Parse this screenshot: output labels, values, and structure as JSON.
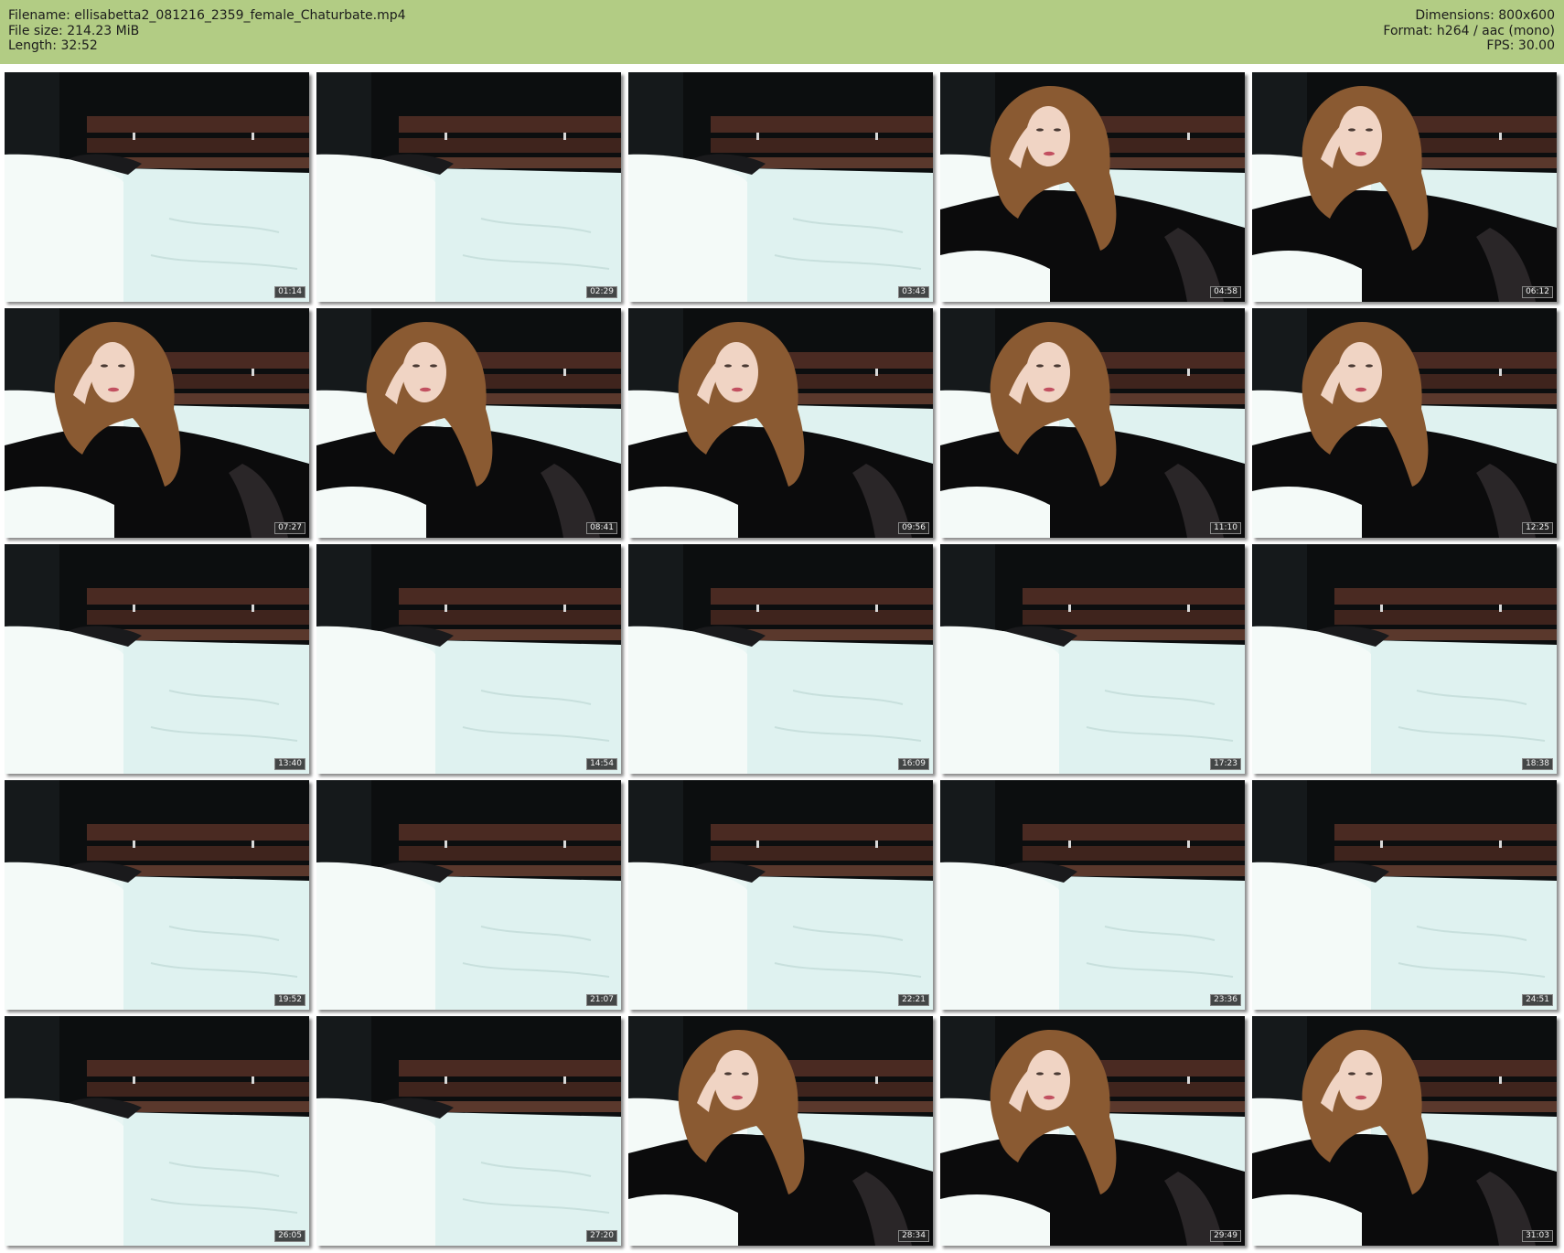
{
  "header": {
    "filename": "Filename: ellisabetta2_081216_2359_female_Chaturbate.mp4",
    "filesize": "File size: 214.23 MiB",
    "length": "Length: 32:52",
    "dimensions": "Dimensions: 800x600",
    "format": "Format: h264 / aac (mono)",
    "fps": "FPS: 30.00"
  },
  "colors": {
    "header_bg": "#b2cc84",
    "frame_dark": "#0c0e0f",
    "headboard": "#4a2a22",
    "sheet": "#e9f6f4",
    "hair": "#8a5a32",
    "dress": "#0b0b0c",
    "skin": "#f0d4c4"
  },
  "frames": [
    {
      "time": "01:14",
      "scene": "empty-bed"
    },
    {
      "time": "02:29",
      "scene": "empty-bed"
    },
    {
      "time": "03:43",
      "scene": "empty-bed"
    },
    {
      "time": "04:58",
      "scene": "woman-reclining"
    },
    {
      "time": "06:12",
      "scene": "woman-reclining"
    },
    {
      "time": "07:27",
      "scene": "woman-reclining"
    },
    {
      "time": "08:41",
      "scene": "woman-reclining"
    },
    {
      "time": "09:56",
      "scene": "woman-reclining"
    },
    {
      "time": "11:10",
      "scene": "woman-reclining"
    },
    {
      "time": "12:25",
      "scene": "woman-reclining"
    },
    {
      "time": "13:40",
      "scene": "empty-bed"
    },
    {
      "time": "14:54",
      "scene": "empty-bed"
    },
    {
      "time": "16:09",
      "scene": "empty-bed"
    },
    {
      "time": "17:23",
      "scene": "empty-bed"
    },
    {
      "time": "18:38",
      "scene": "empty-bed"
    },
    {
      "time": "19:52",
      "scene": "empty-bed"
    },
    {
      "time": "21:07",
      "scene": "empty-bed"
    },
    {
      "time": "22:21",
      "scene": "empty-bed"
    },
    {
      "time": "23:36",
      "scene": "empty-bed"
    },
    {
      "time": "24:51",
      "scene": "empty-bed"
    },
    {
      "time": "26:05",
      "scene": "empty-bed"
    },
    {
      "time": "27:20",
      "scene": "empty-bed"
    },
    {
      "time": "28:34",
      "scene": "woman-reclining"
    },
    {
      "time": "29:49",
      "scene": "woman-reclining"
    },
    {
      "time": "31:03",
      "scene": "woman-reclining"
    }
  ]
}
